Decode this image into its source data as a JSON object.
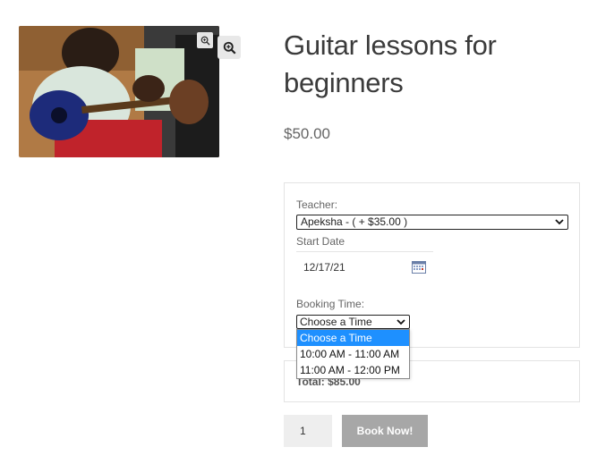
{
  "product": {
    "title": "Guitar lessons for beginners",
    "price": "$50.00",
    "image_alt": "person playing guitar"
  },
  "booking": {
    "teacher_label": "Teacher:",
    "teacher_value": "Apeksha - ( + $35.00 )",
    "start_date_label": "Start Date",
    "start_date_value": "12/17/21",
    "time_label": "Booking Time:",
    "time_value": "Choose a Time",
    "time_options": [
      "Choose a Time",
      "10:00 AM - 11:00 AM",
      "11:00 AM - 12:00 PM"
    ],
    "total_text": "Total: $85.00"
  },
  "cart": {
    "quantity": "1",
    "book_label": "Book Now!"
  },
  "icons": {
    "zoom": "zoom-in-icon",
    "calendar": "calendar-icon",
    "chevron": "chevron-down-icon"
  },
  "colors": {
    "selected_option": "#1e90ff",
    "button_bg": "#a7a7a7"
  }
}
